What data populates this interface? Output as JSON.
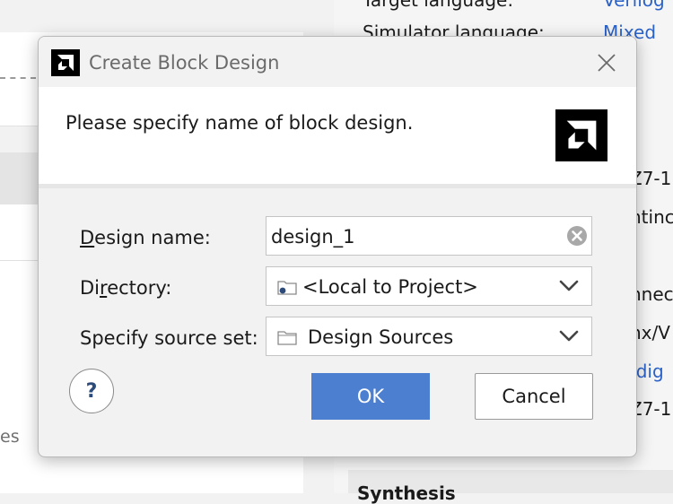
{
  "background": {
    "left_panel_text": "es",
    "right_panel": {
      "target_language_label": "Target language:",
      "target_language_value": "Verilog",
      "simulator_language_label": "Simulator language:",
      "simulator_language_value": "Mixed",
      "fragment_1": "Z7-1",
      "fragment_2": "ntinc",
      "fragment_3": "nnec",
      "fragment_4": "nx/V",
      "fragment_5": "/dig",
      "fragment_6": "Z7-1",
      "bottom_heading": "Synthesis"
    },
    "link_color": "#2b62c8"
  },
  "dialog": {
    "title": "Create Block Design",
    "header_message": "Please specify name of block design.",
    "fields": {
      "design_name": {
        "label_mnemonic": "D",
        "label_rest": "esign name:",
        "value": "design_1"
      },
      "directory": {
        "label_prefix": "Di",
        "label_mnemonic": "r",
        "label_rest": "ectory:",
        "value": "<Local to Project>"
      },
      "source_set": {
        "label": "Specify source set:",
        "value": "Design Sources"
      }
    },
    "buttons": {
      "help": "?",
      "ok": "OK",
      "cancel": "Cancel"
    },
    "colors": {
      "primary_button": "#4d7fd1",
      "logo": "#000000"
    },
    "icons": {
      "logo": "amd-logo-icon",
      "close": "close-icon",
      "clear": "clear-circle-icon",
      "folder": "folder-icon",
      "dropdown": "chevron-down-icon"
    }
  }
}
